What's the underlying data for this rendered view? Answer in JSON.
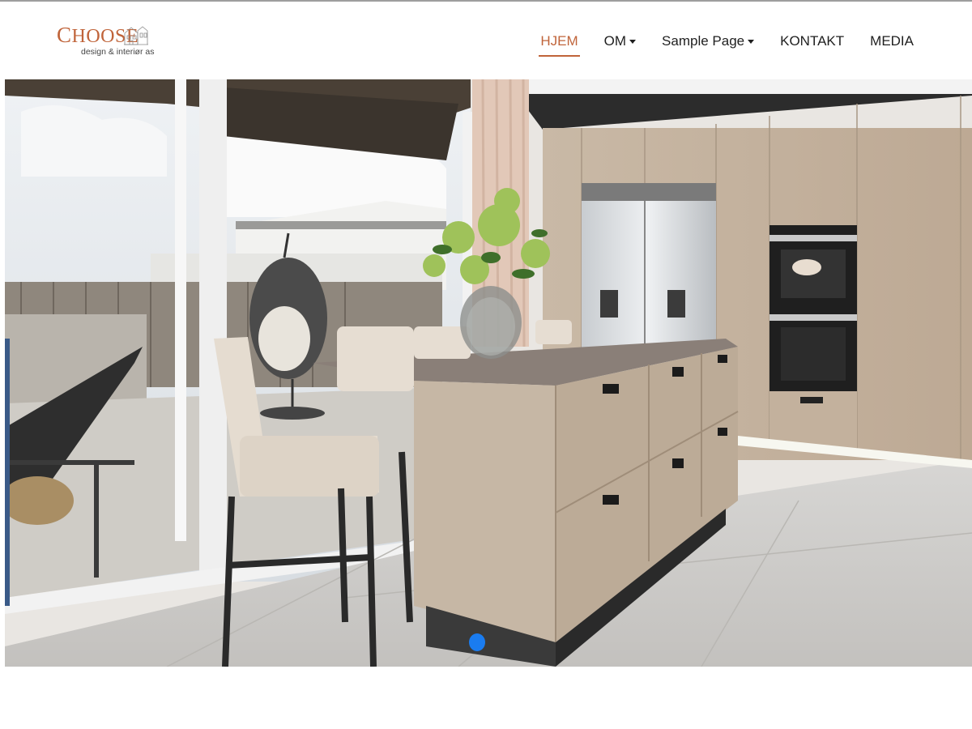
{
  "brand": {
    "name": "CHOOSE",
    "tagline": "design & interiør as",
    "accent_color": "#c0643a"
  },
  "nav": {
    "items": [
      {
        "label": "HJEM",
        "active": true,
        "dropdown": false
      },
      {
        "label": "OM",
        "active": false,
        "dropdown": true
      },
      {
        "label": "Sample Page",
        "active": false,
        "dropdown": true
      },
      {
        "label": "KONTAKT",
        "active": false,
        "dropdown": false
      },
      {
        "label": "MEDIA",
        "active": false,
        "dropdown": false
      }
    ]
  },
  "carousel": {
    "slide_count": 2,
    "active_index": 0,
    "active_dot_color": "#1a7cf0",
    "slide_description_icon": "kitchen-photo"
  }
}
